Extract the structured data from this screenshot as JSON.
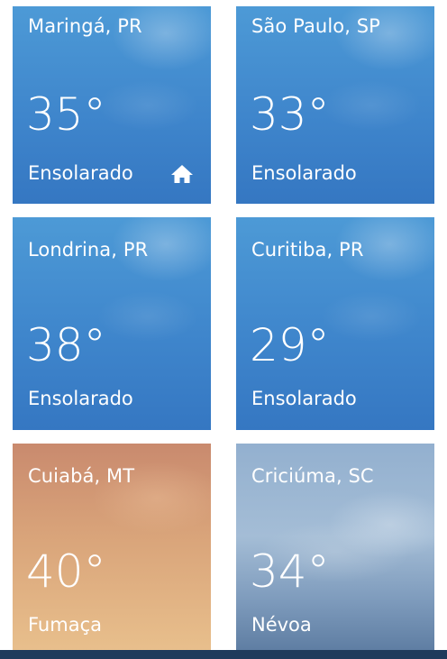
{
  "tiles": [
    {
      "city": "Maringá, PR",
      "temp": "35°",
      "condition": "Ensolarado",
      "is_home": true,
      "theme": "sunny"
    },
    {
      "city": "São Paulo, SP",
      "temp": "33°",
      "condition": "Ensolarado",
      "is_home": false,
      "theme": "sunny"
    },
    {
      "city": "Londrina, PR",
      "temp": "38°",
      "condition": "Ensolarado",
      "is_home": false,
      "theme": "sunny"
    },
    {
      "city": "Curitiba, PR",
      "temp": "29°",
      "condition": "Ensolarado",
      "is_home": false,
      "theme": "sunny"
    },
    {
      "city": "Cuiabá, MT",
      "temp": "40°",
      "condition": "Fumaça",
      "is_home": false,
      "theme": "smoke"
    },
    {
      "city": "Criciúma, SC",
      "temp": "34°",
      "condition": "Névoa",
      "is_home": false,
      "theme": "mist"
    }
  ],
  "colors": {
    "sunny": "#3f86cc",
    "smoke": "#d9a47a",
    "mist": "#93b0cf",
    "bottom_bar": "#1f3b5c"
  }
}
